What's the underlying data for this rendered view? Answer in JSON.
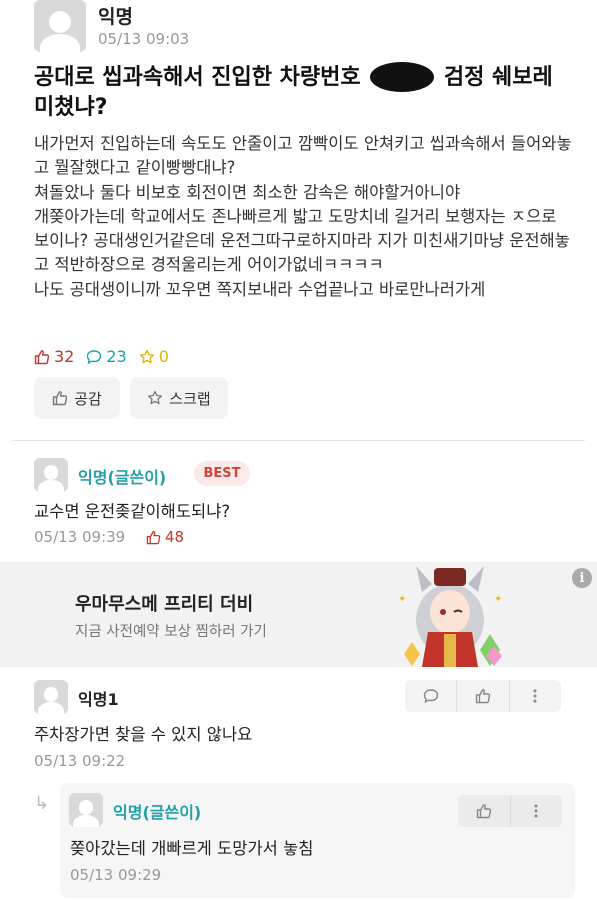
{
  "post": {
    "author": "익명",
    "time": "05/13 09:03",
    "title_before": "공대로 씹과속해서 진입한 차량번호 ",
    "title_after": " 검정 쉐보레 미쳤냐?",
    "body": "내가먼저 진입하는데 속도도 안줄이고 깜빡이도 안쳐키고 씹과속해서 들어와놓고 뭘잘했다고 같이빵빵대냐?\n쳐돌았나 둘다 비보호 회전이면 최소한 감속은 해야할거아니야\n개쫒아가는데 학교에서도 존나빠르게 밟고 도망치네 길거리 보행자는 ㅈ으로 보이나? 공대생인거같은데 운전그따구로하지마라 지가 미친새기마냥 운전해놓고 적반하장으로 경적울리는게 어이가없네ㅋㅋㅋㅋ\n나도 공대생이니까 꼬우면 쪽지보내라 수업끝나고 바로만나러가게",
    "likes": "32",
    "comments": "23",
    "scraps": "0",
    "like_button": "공감",
    "scrap_button": "스크랩"
  },
  "best_comment": {
    "author": "익명(글쓴이)",
    "badge": "BEST",
    "text": "교수면 운전좆같이해도되냐?",
    "time": "05/13 09:39",
    "likes": "48"
  },
  "ad": {
    "title": "우마무스메 프리티 더비",
    "subtitle": "지금 사전예약 보상 찜하러 가기",
    "info_icon": "i"
  },
  "comment2": {
    "author": "익명1",
    "text": "주차장가면 찾을 수 있지 않나요",
    "time": "05/13 09:22"
  },
  "reply": {
    "author": "익명(글쓴이)",
    "text": "쫒아갔는데 개빠르게 도망가서 놓침",
    "time": "05/13 09:29"
  },
  "colors": {
    "like": "#c0392b",
    "comment": "#17a2b8",
    "scrap": "#e0b000",
    "author_op": "#23a0a8",
    "best_badge_bg": "#fbeaea"
  }
}
